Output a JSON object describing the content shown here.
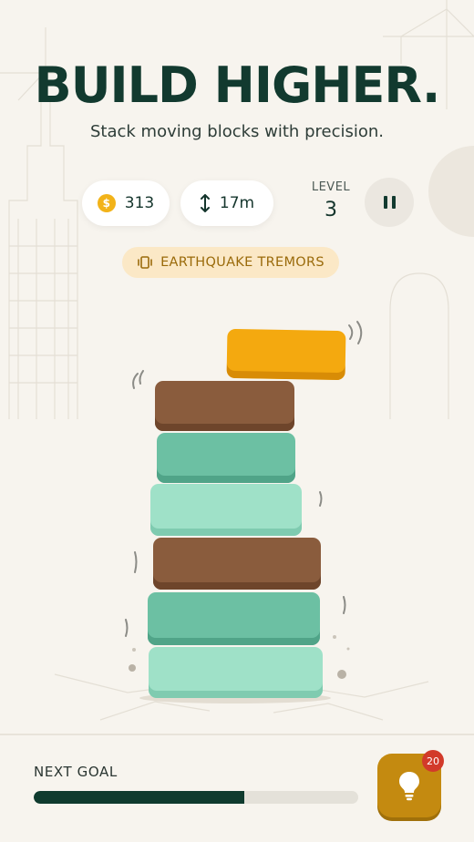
{
  "header": {
    "title": "BUILD HIGHER.",
    "subtitle": "Stack moving blocks with precision."
  },
  "stats": {
    "coins": "313",
    "coin_symbol": "$",
    "height": "17m",
    "level_label": "LEVEL",
    "level_value": "3"
  },
  "event": {
    "label": "EARTHQUAKE TREMORS",
    "icon": "vibration-icon"
  },
  "tower": {
    "blocks": [
      {
        "name": "moving-block",
        "color": "#f4a90f",
        "state": "moving"
      },
      {
        "name": "brown-block",
        "color": "#8a5c3d"
      },
      {
        "name": "teal-block",
        "color": "#6cc0a3"
      },
      {
        "name": "mint-block",
        "color": "#9fe1c8"
      },
      {
        "name": "brown-block",
        "color": "#8a5c3d"
      },
      {
        "name": "teal-block",
        "color": "#6cc0a3"
      },
      {
        "name": "mint-block",
        "color": "#9fe1c8"
      }
    ]
  },
  "footer": {
    "goal_label": "NEXT GOAL",
    "goal_progress": 0.65,
    "hint_count": "20"
  },
  "colors": {
    "primary": "#123a2f",
    "accent": "#c48a10",
    "badge": "#d23a2a"
  }
}
